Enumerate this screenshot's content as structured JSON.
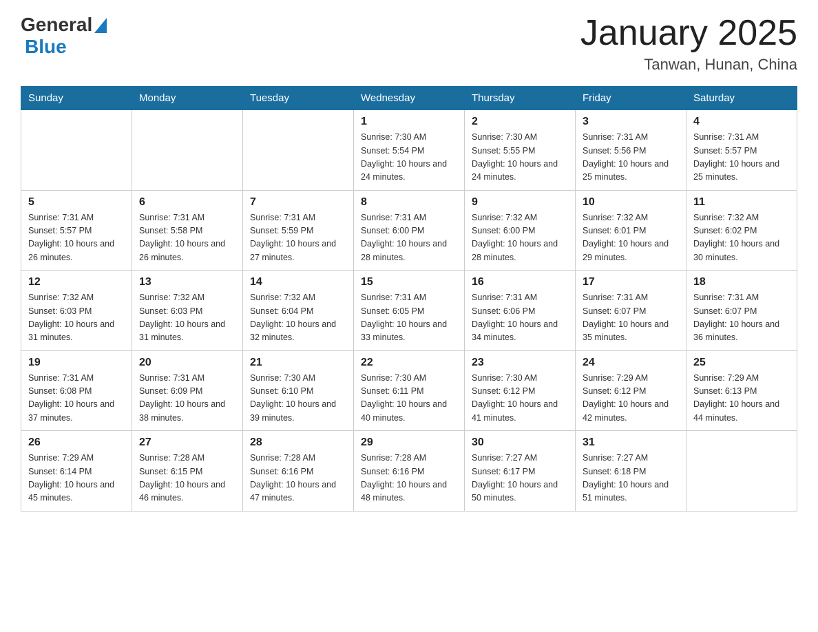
{
  "header": {
    "logo_general": "General",
    "logo_blue": "Blue",
    "title": "January 2025",
    "subtitle": "Tanwan, Hunan, China"
  },
  "days_of_week": [
    "Sunday",
    "Monday",
    "Tuesday",
    "Wednesday",
    "Thursday",
    "Friday",
    "Saturday"
  ],
  "weeks": [
    [
      {
        "day": "",
        "sunrise": "",
        "sunset": "",
        "daylight": ""
      },
      {
        "day": "",
        "sunrise": "",
        "sunset": "",
        "daylight": ""
      },
      {
        "day": "",
        "sunrise": "",
        "sunset": "",
        "daylight": ""
      },
      {
        "day": "1",
        "sunrise": "Sunrise: 7:30 AM",
        "sunset": "Sunset: 5:54 PM",
        "daylight": "Daylight: 10 hours and 24 minutes."
      },
      {
        "day": "2",
        "sunrise": "Sunrise: 7:30 AM",
        "sunset": "Sunset: 5:55 PM",
        "daylight": "Daylight: 10 hours and 24 minutes."
      },
      {
        "day": "3",
        "sunrise": "Sunrise: 7:31 AM",
        "sunset": "Sunset: 5:56 PM",
        "daylight": "Daylight: 10 hours and 25 minutes."
      },
      {
        "day": "4",
        "sunrise": "Sunrise: 7:31 AM",
        "sunset": "Sunset: 5:57 PM",
        "daylight": "Daylight: 10 hours and 25 minutes."
      }
    ],
    [
      {
        "day": "5",
        "sunrise": "Sunrise: 7:31 AM",
        "sunset": "Sunset: 5:57 PM",
        "daylight": "Daylight: 10 hours and 26 minutes."
      },
      {
        "day": "6",
        "sunrise": "Sunrise: 7:31 AM",
        "sunset": "Sunset: 5:58 PM",
        "daylight": "Daylight: 10 hours and 26 minutes."
      },
      {
        "day": "7",
        "sunrise": "Sunrise: 7:31 AM",
        "sunset": "Sunset: 5:59 PM",
        "daylight": "Daylight: 10 hours and 27 minutes."
      },
      {
        "day": "8",
        "sunrise": "Sunrise: 7:31 AM",
        "sunset": "Sunset: 6:00 PM",
        "daylight": "Daylight: 10 hours and 28 minutes."
      },
      {
        "day": "9",
        "sunrise": "Sunrise: 7:32 AM",
        "sunset": "Sunset: 6:00 PM",
        "daylight": "Daylight: 10 hours and 28 minutes."
      },
      {
        "day": "10",
        "sunrise": "Sunrise: 7:32 AM",
        "sunset": "Sunset: 6:01 PM",
        "daylight": "Daylight: 10 hours and 29 minutes."
      },
      {
        "day": "11",
        "sunrise": "Sunrise: 7:32 AM",
        "sunset": "Sunset: 6:02 PM",
        "daylight": "Daylight: 10 hours and 30 minutes."
      }
    ],
    [
      {
        "day": "12",
        "sunrise": "Sunrise: 7:32 AM",
        "sunset": "Sunset: 6:03 PM",
        "daylight": "Daylight: 10 hours and 31 minutes."
      },
      {
        "day": "13",
        "sunrise": "Sunrise: 7:32 AM",
        "sunset": "Sunset: 6:03 PM",
        "daylight": "Daylight: 10 hours and 31 minutes."
      },
      {
        "day": "14",
        "sunrise": "Sunrise: 7:32 AM",
        "sunset": "Sunset: 6:04 PM",
        "daylight": "Daylight: 10 hours and 32 minutes."
      },
      {
        "day": "15",
        "sunrise": "Sunrise: 7:31 AM",
        "sunset": "Sunset: 6:05 PM",
        "daylight": "Daylight: 10 hours and 33 minutes."
      },
      {
        "day": "16",
        "sunrise": "Sunrise: 7:31 AM",
        "sunset": "Sunset: 6:06 PM",
        "daylight": "Daylight: 10 hours and 34 minutes."
      },
      {
        "day": "17",
        "sunrise": "Sunrise: 7:31 AM",
        "sunset": "Sunset: 6:07 PM",
        "daylight": "Daylight: 10 hours and 35 minutes."
      },
      {
        "day": "18",
        "sunrise": "Sunrise: 7:31 AM",
        "sunset": "Sunset: 6:07 PM",
        "daylight": "Daylight: 10 hours and 36 minutes."
      }
    ],
    [
      {
        "day": "19",
        "sunrise": "Sunrise: 7:31 AM",
        "sunset": "Sunset: 6:08 PM",
        "daylight": "Daylight: 10 hours and 37 minutes."
      },
      {
        "day": "20",
        "sunrise": "Sunrise: 7:31 AM",
        "sunset": "Sunset: 6:09 PM",
        "daylight": "Daylight: 10 hours and 38 minutes."
      },
      {
        "day": "21",
        "sunrise": "Sunrise: 7:30 AM",
        "sunset": "Sunset: 6:10 PM",
        "daylight": "Daylight: 10 hours and 39 minutes."
      },
      {
        "day": "22",
        "sunrise": "Sunrise: 7:30 AM",
        "sunset": "Sunset: 6:11 PM",
        "daylight": "Daylight: 10 hours and 40 minutes."
      },
      {
        "day": "23",
        "sunrise": "Sunrise: 7:30 AM",
        "sunset": "Sunset: 6:12 PM",
        "daylight": "Daylight: 10 hours and 41 minutes."
      },
      {
        "day": "24",
        "sunrise": "Sunrise: 7:29 AM",
        "sunset": "Sunset: 6:12 PM",
        "daylight": "Daylight: 10 hours and 42 minutes."
      },
      {
        "day": "25",
        "sunrise": "Sunrise: 7:29 AM",
        "sunset": "Sunset: 6:13 PM",
        "daylight": "Daylight: 10 hours and 44 minutes."
      }
    ],
    [
      {
        "day": "26",
        "sunrise": "Sunrise: 7:29 AM",
        "sunset": "Sunset: 6:14 PM",
        "daylight": "Daylight: 10 hours and 45 minutes."
      },
      {
        "day": "27",
        "sunrise": "Sunrise: 7:28 AM",
        "sunset": "Sunset: 6:15 PM",
        "daylight": "Daylight: 10 hours and 46 minutes."
      },
      {
        "day": "28",
        "sunrise": "Sunrise: 7:28 AM",
        "sunset": "Sunset: 6:16 PM",
        "daylight": "Daylight: 10 hours and 47 minutes."
      },
      {
        "day": "29",
        "sunrise": "Sunrise: 7:28 AM",
        "sunset": "Sunset: 6:16 PM",
        "daylight": "Daylight: 10 hours and 48 minutes."
      },
      {
        "day": "30",
        "sunrise": "Sunrise: 7:27 AM",
        "sunset": "Sunset: 6:17 PM",
        "daylight": "Daylight: 10 hours and 50 minutes."
      },
      {
        "day": "31",
        "sunrise": "Sunrise: 7:27 AM",
        "sunset": "Sunset: 6:18 PM",
        "daylight": "Daylight: 10 hours and 51 minutes."
      },
      {
        "day": "",
        "sunrise": "",
        "sunset": "",
        "daylight": ""
      }
    ]
  ]
}
